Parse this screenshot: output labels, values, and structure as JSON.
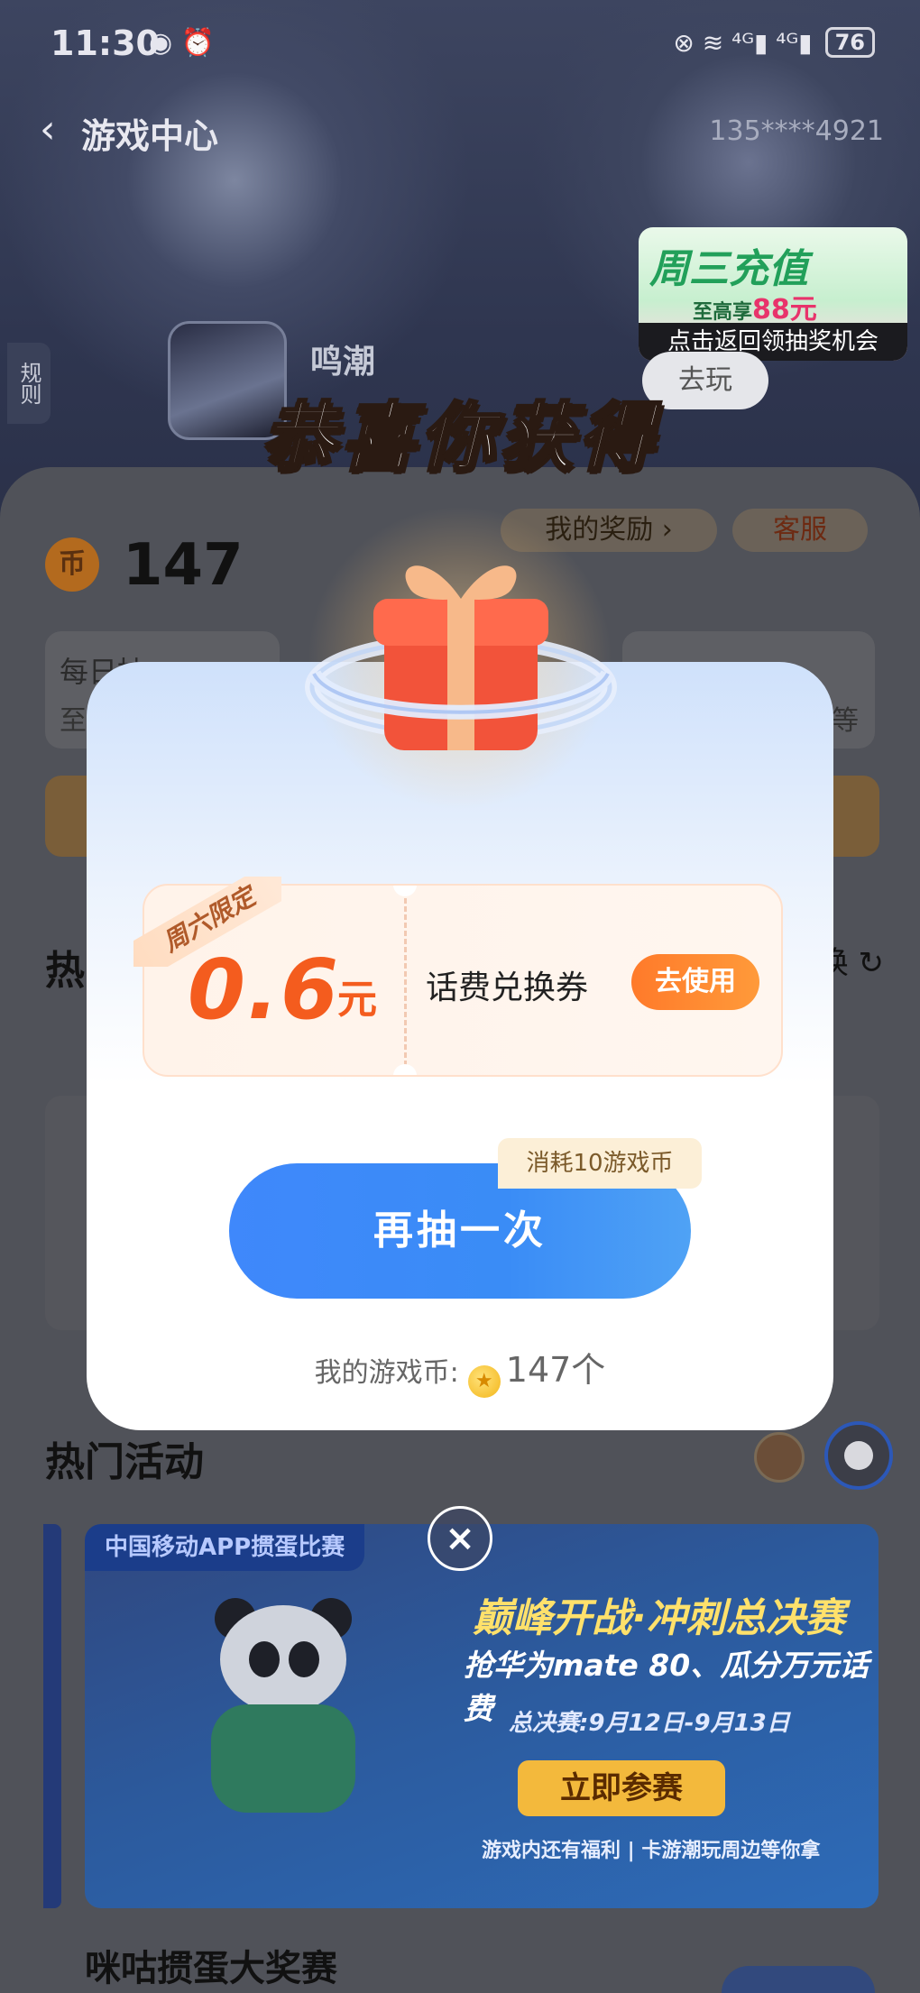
{
  "status_bar": {
    "time": "11:30",
    "left_icons": "◉ ⏰",
    "right_icons": "⊗ ≋ ⁴ᴳ▮ ⁴ᴳ▮",
    "battery": "76"
  },
  "nav": {
    "back_icon": "‹",
    "title": "游戏中心",
    "phone": "135****4921"
  },
  "promo": {
    "title": "周三充值",
    "sub_prefix": "至高享",
    "sub_amount": "88元",
    "bar_text": "点击返回领抽奖机会"
  },
  "rules_label": "规则",
  "game": {
    "name": "鸣潮",
    "play_label": "去玩"
  },
  "wallet": {
    "coin_badge": "币",
    "count": "147",
    "rewards_label": "我的奖励 ›",
    "service_label": "客服"
  },
  "daily": {
    "title": "每日抽",
    "sub": "至",
    "right_sub": "不等"
  },
  "hot": {
    "title": "热",
    "refresh_icon": "换 ↻"
  },
  "activities": {
    "title": "热门活动",
    "banner": {
      "tag": "中国移动APP掼蛋比赛",
      "headline": "巅峰开战·冲刺总决赛",
      "subline": "抢华为mate 80、瓜分万元话费",
      "date": "总决赛:9月12日-9月13日",
      "button": "立即参赛",
      "footer": "游戏内还有福利 | 卡游潮玩周边等你拿"
    },
    "next_title": "咪咕掼蛋大奖赛"
  },
  "modal": {
    "headline": "恭喜你获得",
    "coupon": {
      "ribbon": "周六限定",
      "amount": "0.6",
      "unit": "元",
      "name": "话费兑换券",
      "use_button": "去使用"
    },
    "cost_tag": "消耗10游戏币",
    "again_button": "再抽一次",
    "coins_label": "我的游戏币:",
    "coins_value": "147个",
    "close_icon": "×"
  },
  "colors": {
    "accent_orange": "#f45c1e",
    "button_blue": "#3f88fb",
    "promo_green": "#22a05a"
  }
}
